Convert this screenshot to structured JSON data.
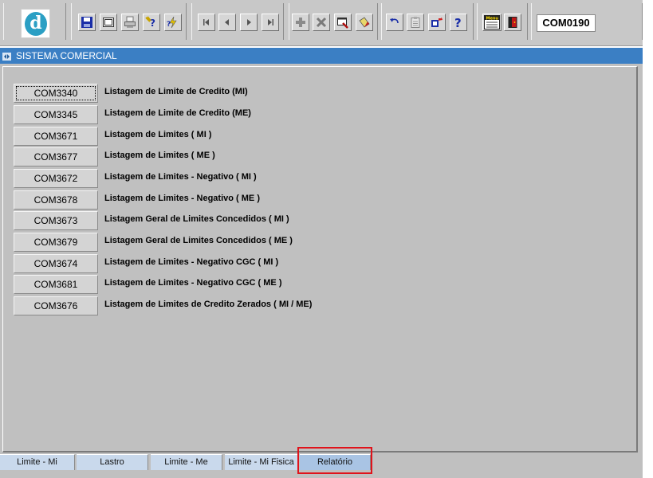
{
  "toolbar": {
    "logo_letter": "d",
    "screen_code": "COM0190",
    "buttons": [
      {
        "icon": "save-icon"
      },
      {
        "icon": "window-icon"
      },
      {
        "icon": "printer-icon"
      },
      {
        "icon": "help-query-icon"
      },
      {
        "icon": "execute-query-icon"
      },
      {
        "icon": "first-record-icon"
      },
      {
        "icon": "previous-record-icon"
      },
      {
        "icon": "next-record-icon"
      },
      {
        "icon": "last-record-icon"
      },
      {
        "icon": "insert-record-icon"
      },
      {
        "icon": "delete-record-icon"
      },
      {
        "icon": "duplicate-record-icon"
      },
      {
        "icon": "clear-record-icon"
      },
      {
        "icon": "undo-icon"
      },
      {
        "icon": "clipboard-icon"
      },
      {
        "icon": "export-icon"
      },
      {
        "icon": "help-icon"
      },
      {
        "icon": "menu-icon",
        "label": "Menu"
      },
      {
        "icon": "exit-icon"
      }
    ]
  },
  "window": {
    "title": "SISTEMA COMERCIAL"
  },
  "reports": [
    {
      "code": "COM3340",
      "label": "Listagem de Limite de Credito (MI)"
    },
    {
      "code": "COM3345",
      "label": "Listagem de Limite de Credito (ME)"
    },
    {
      "code": "COM3671",
      "label": "Listagem de Limites ( MI )"
    },
    {
      "code": "COM3677",
      "label": "Listagem de Limites ( ME )"
    },
    {
      "code": "COM3672",
      "label": "Listagem de Limites - Negativo ( MI )"
    },
    {
      "code": "COM3678",
      "label": "Listagem de Limites - Negativo ( ME )"
    },
    {
      "code": "COM3673",
      "label": "Listagem Geral de Limites Concedidos ( MI )"
    },
    {
      "code": "COM3679",
      "label": "Listagem Geral de Limites Concedidos ( ME )"
    },
    {
      "code": "COM3674",
      "label": "Listagem de Limites - Negativo CGC ( MI )"
    },
    {
      "code": "COM3681",
      "label": "Listagem de Limites - Negativo CGC ( ME )"
    },
    {
      "code": "COM3676",
      "label": "Listagem de Limites de Credito Zerados ( MI / ME)"
    }
  ],
  "tabs": [
    {
      "label": "Limite - Mi"
    },
    {
      "label": "Lastro"
    },
    {
      "label": "Limite - Me"
    },
    {
      "label": "Limite - Mi Fisica"
    },
    {
      "label": "Relatório",
      "active": true
    }
  ],
  "colors": {
    "title_bar": "#3b7fc4",
    "panel": "#c0c0c0",
    "tab": "#c9d9ec",
    "tab_active": "#a9c4e4",
    "highlight": "#e0131b"
  }
}
